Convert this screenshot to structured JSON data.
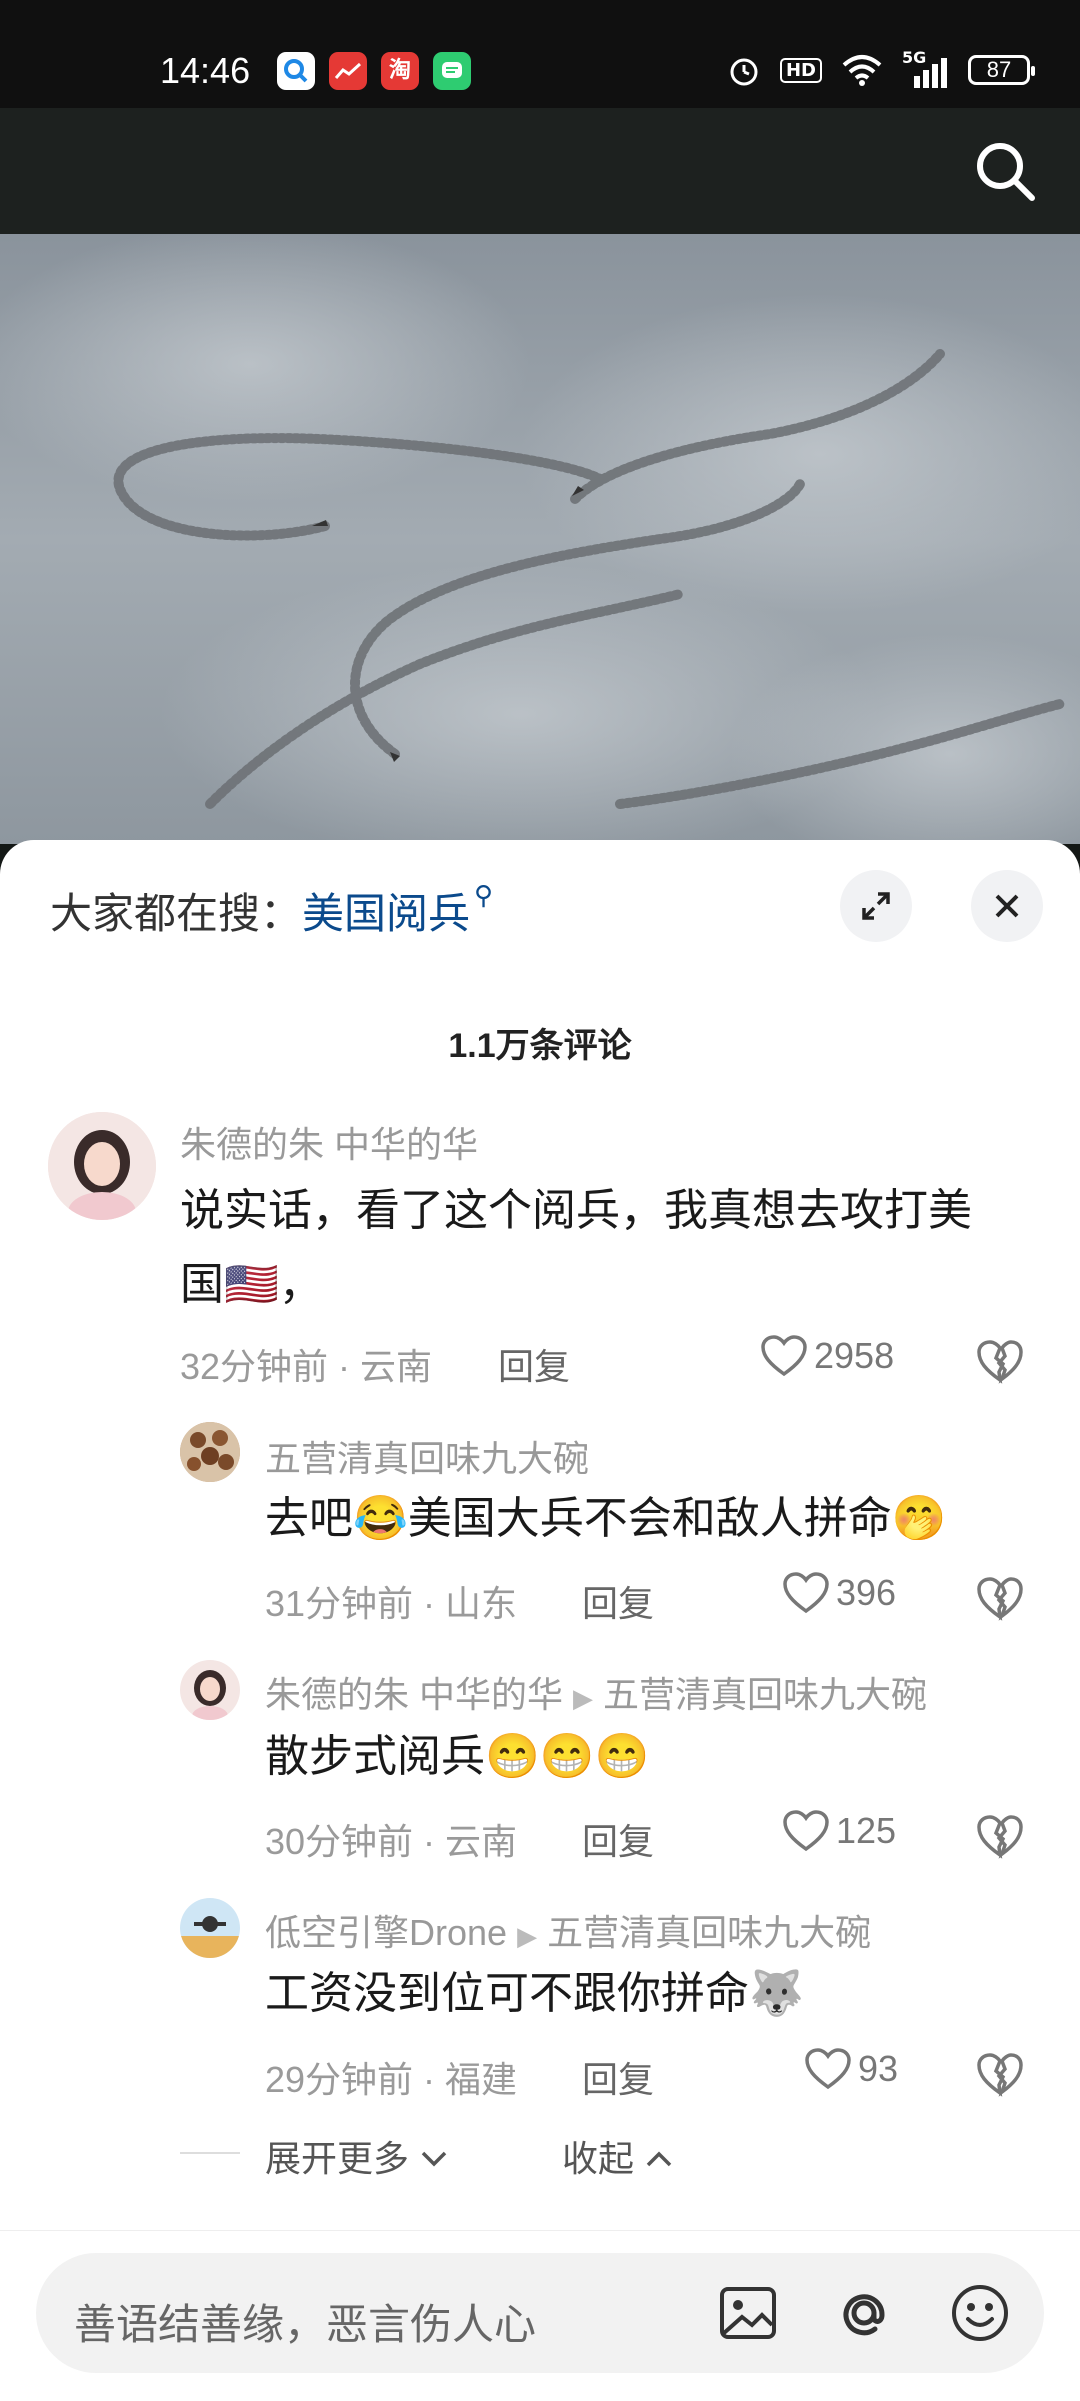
{
  "status_bar": {
    "time": "14:46",
    "signal": "5G",
    "battery": "87"
  },
  "trending": {
    "prefix": "大家都在搜：",
    "keyword": "美国阅兵"
  },
  "comments_count": "1.1万条评论",
  "comments": [
    {
      "user": "朱德的朱 中华的华",
      "text": "说实话，看了这个阅兵，我真想去攻打美国🇺🇸，",
      "time_location": "32分钟前 · 云南",
      "reply_label": "回复",
      "likes": "2958"
    }
  ],
  "replies": [
    {
      "user": "五营清真回味九大碗",
      "text": "去吧😂美国大兵不会和敌人拼命🤭",
      "time_location": "31分钟前 · 山东",
      "reply_label": "回复",
      "likes": "396"
    },
    {
      "user": "朱德的朱 中华的华",
      "reply_to": "五营清真回味九大碗",
      "text": "散步式阅兵😁😁😁",
      "time_location": "30分钟前 · 云南",
      "reply_label": "回复",
      "likes": "125"
    },
    {
      "user": "低空引擎Drone",
      "reply_to": "五营清真回味九大碗",
      "text": "工资没到位可不跟你拼命🐺",
      "time_location": "29分钟前 · 福建",
      "reply_label": "回复",
      "likes": "93"
    }
  ],
  "thread_controls": {
    "expand_more": "展开更多",
    "collapse": "收起"
  },
  "input": {
    "placeholder": "善语结善缘，恶言伤人心"
  }
}
